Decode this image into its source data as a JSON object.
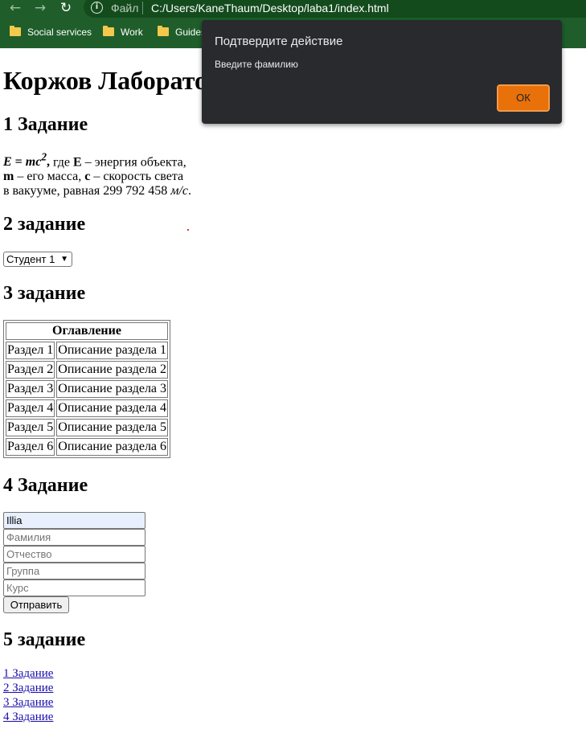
{
  "browser": {
    "file_label": "Файл",
    "url": "C:/Users/KaneThaum/Desktop/laba1/index.html",
    "nav_icons": [
      "back-arrow-icon",
      "forward-arrow-icon",
      "reload-icon",
      "info-icon"
    ],
    "bookmarks": [
      "Social services",
      "Work",
      "Guides"
    ]
  },
  "page": {
    "title": "Коржов Лаборато",
    "task1": {
      "heading": "1 Задание",
      "formula_e": "E",
      "formula_eq": " = ",
      "formula_mc": "mc",
      "formula_pow": "2",
      "formula_comma": ",",
      "text1": " где ",
      "bold_e": "E",
      "text2": " – энергия объекта,",
      "bold_m": "m",
      "text3": " – его масса, ",
      "bold_c": "c",
      "text4": " – скорость света",
      "text5": "в вакууме, равная 299 792 458 ",
      "unit": "м/с",
      "text6": "."
    },
    "task2": {
      "heading": "2 задание",
      "select_value": "Студент 1"
    },
    "task3": {
      "heading": "3 задание",
      "table_header": "Оглавление",
      "rows": [
        [
          "Раздел 1",
          "Описание раздела 1"
        ],
        [
          "Раздел 2",
          "Описание раздела 2"
        ],
        [
          "Раздел 3",
          "Описание раздела 3"
        ],
        [
          "Раздел 4",
          "Описание раздела 4"
        ],
        [
          "Раздел 5",
          "Описание раздела 5"
        ],
        [
          "Раздел 6",
          "Описание раздела 6"
        ]
      ]
    },
    "task4": {
      "heading": "4 Задание",
      "name_value": "Illia",
      "surname_placeholder": "Фамилия",
      "patronymic_placeholder": "Отчество",
      "group_placeholder": "Группа",
      "course_placeholder": "Курс",
      "submit_label": "Отправить"
    },
    "task5": {
      "heading": "5 задание",
      "links": [
        "1 Задание",
        "2 Задание",
        "3 Задание",
        "4 Задание"
      ]
    }
  },
  "dialog": {
    "title": "Подтвердите действие",
    "message": "Введите фамилию",
    "ok_label": "ОК",
    "ok_color": "#e8710a"
  }
}
